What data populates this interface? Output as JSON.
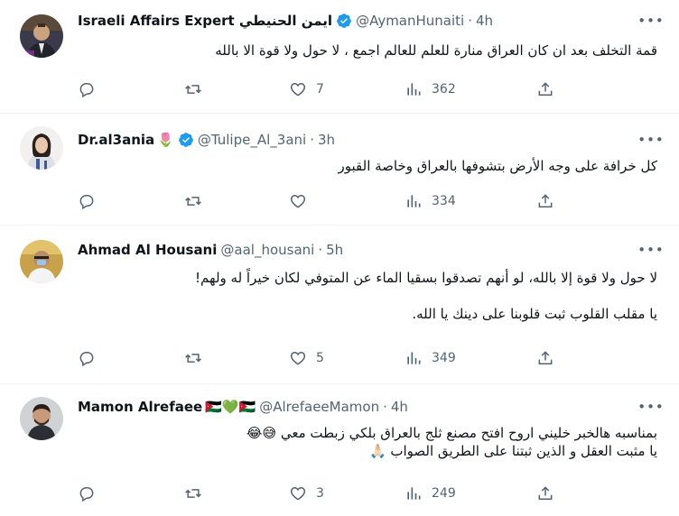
{
  "colors": {
    "text": "#0f1419",
    "secondary": "#536471",
    "verified": "#1d9bf0",
    "divider": "#eff3f4"
  },
  "tweets": [
    {
      "name": "Israeli Affairs Expert ايمن الحنيطي",
      "verified": true,
      "emoji": "",
      "handle": "@AymanHunaiti",
      "sep": "·",
      "time": "4h",
      "lines": [
        "قمة التخلف بعد ان كان العراق منارة للعلم للعالم اجمع ، لا حول ولا قوة الا بالله"
      ],
      "replies": "",
      "retweets": "",
      "likes": "7",
      "views": "362"
    },
    {
      "name": "Dr.al3ania",
      "verified": true,
      "emoji": "🌷",
      "handle": "@Tulipe_Al_3ani",
      "sep": "·",
      "time": "3h",
      "lines": [
        "كل خرافة على وجه الأرض بتشوفها بالعراق وخاصة القبور"
      ],
      "replies": "",
      "retweets": "",
      "likes": "",
      "views": "334"
    },
    {
      "name": "Ahmad Al Housani",
      "verified": false,
      "emoji": "",
      "handle": "@aal_housani",
      "sep": "·",
      "time": "5h",
      "lines": [
        "لا حول ولا قوة إلا بالله، لو أنهم تصدقوا بسقيا الماء عن المتوفي لكان خيراً له ولهم!",
        "",
        "يا مقلب القلوب ثبت قلوبنا على دينك يا الله."
      ],
      "replies": "",
      "retweets": "",
      "likes": "5",
      "views": "349"
    },
    {
      "name": "Mamon Alrefaee",
      "verified": false,
      "emoji": "🇯🇴💚🇯🇴",
      "handle": "@AlrefaeeMamon",
      "sep": "·",
      "time": "4h",
      "lines": [
        "بمناسبه هالخبر خليني اروح افتح مصنع ثلج بالعراق بلكي زبطت معي 😅😂",
        "يا مثبت العقل و الذين ثبتنا على الطريق الصواب 🙏🏻"
      ],
      "replies": "",
      "retweets": "",
      "likes": "3",
      "views": "249"
    }
  ]
}
